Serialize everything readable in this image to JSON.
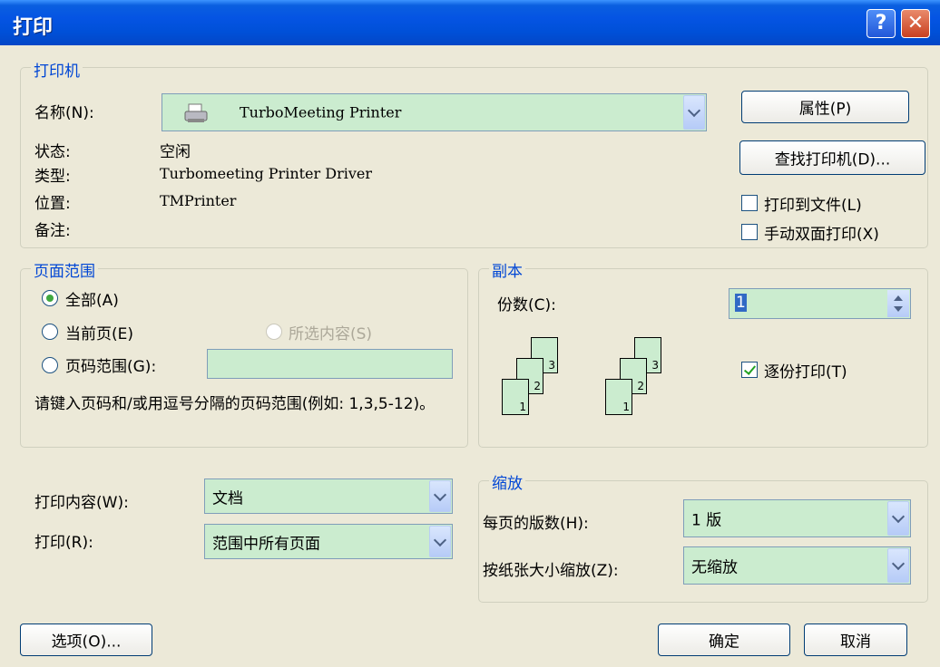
{
  "window": {
    "title": "打印",
    "help_label": "?",
    "close_label": "✕"
  },
  "printer": {
    "legend": "打印机",
    "name_label": "名称(N):",
    "name_value": "TurboMeeting Printer",
    "status_label": "状态:",
    "status_value": "空闲",
    "type_label": "类型:",
    "type_value": "Turbomeeting Printer Driver",
    "location_label": "位置:",
    "location_value": "TMPrinter",
    "comment_label": "备注:",
    "properties_button": "属性(P)",
    "find_printer_button": "查找打印机(D)...",
    "print_to_file": {
      "label": "打印到文件(L)",
      "checked": false
    },
    "manual_duplex": {
      "label": "手动双面打印(X)",
      "checked": false
    }
  },
  "page_range": {
    "legend": "页面范围",
    "all": {
      "label": "全部(A)",
      "selected": true
    },
    "current_page": {
      "label": "当前页(E)",
      "selected": false
    },
    "selection": {
      "label": "所选内容(S)",
      "enabled": false
    },
    "pages": {
      "label": "页码范围(G):",
      "value": ""
    },
    "hint": "请键入页码和/或用逗号分隔的页码范围(例如: 1,3,5-12)。"
  },
  "copies": {
    "legend": "副本",
    "count_label": "份数(C):",
    "count_value": "1",
    "collate": {
      "label": "逐份打印(T)",
      "checked": true
    },
    "page_numbers": [
      "1",
      "2",
      "3"
    ]
  },
  "print_what": {
    "content_label": "打印内容(W):",
    "content_value": "文档",
    "print_label": "打印(R):",
    "print_value": "范围中所有页面"
  },
  "zoom": {
    "legend": "缩放",
    "pages_per_sheet_label": "每页的版数(H):",
    "pages_per_sheet_value": "1 版",
    "scale_label": "按纸张大小缩放(Z):",
    "scale_value": "无缩放"
  },
  "footer": {
    "options_button": "选项(O)...",
    "ok_button": "确定",
    "cancel_button": "取消"
  }
}
